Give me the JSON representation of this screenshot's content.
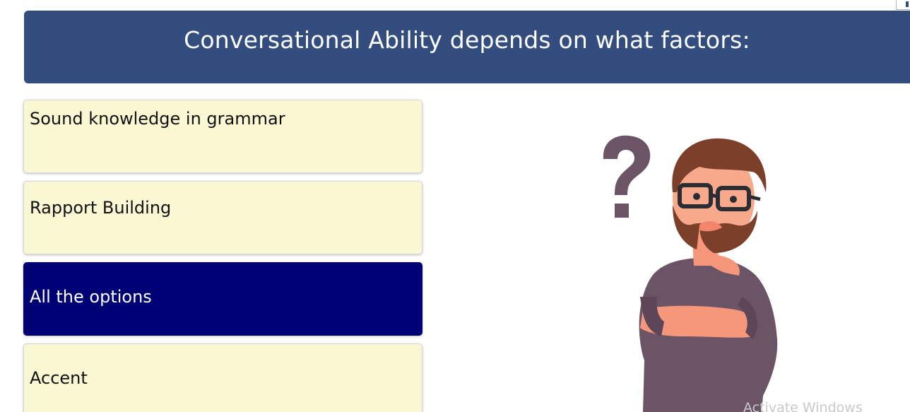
{
  "question": {
    "title": "Conversational Ability depends on what factors:"
  },
  "options": [
    {
      "label": "Sound knowledge in grammar",
      "selected": false
    },
    {
      "label": "Rapport Building",
      "selected": false
    },
    {
      "label": "All the options",
      "selected": true
    },
    {
      "label": "Accent",
      "selected": false
    }
  ],
  "illustration": {
    "icon": "thinking-man-question-mark-icon"
  },
  "watermark": {
    "text": "Activate Windows"
  },
  "colors": {
    "header_bg": "#334e7e",
    "option_bg": "#f9f8d3",
    "selected_bg": "#000175"
  }
}
